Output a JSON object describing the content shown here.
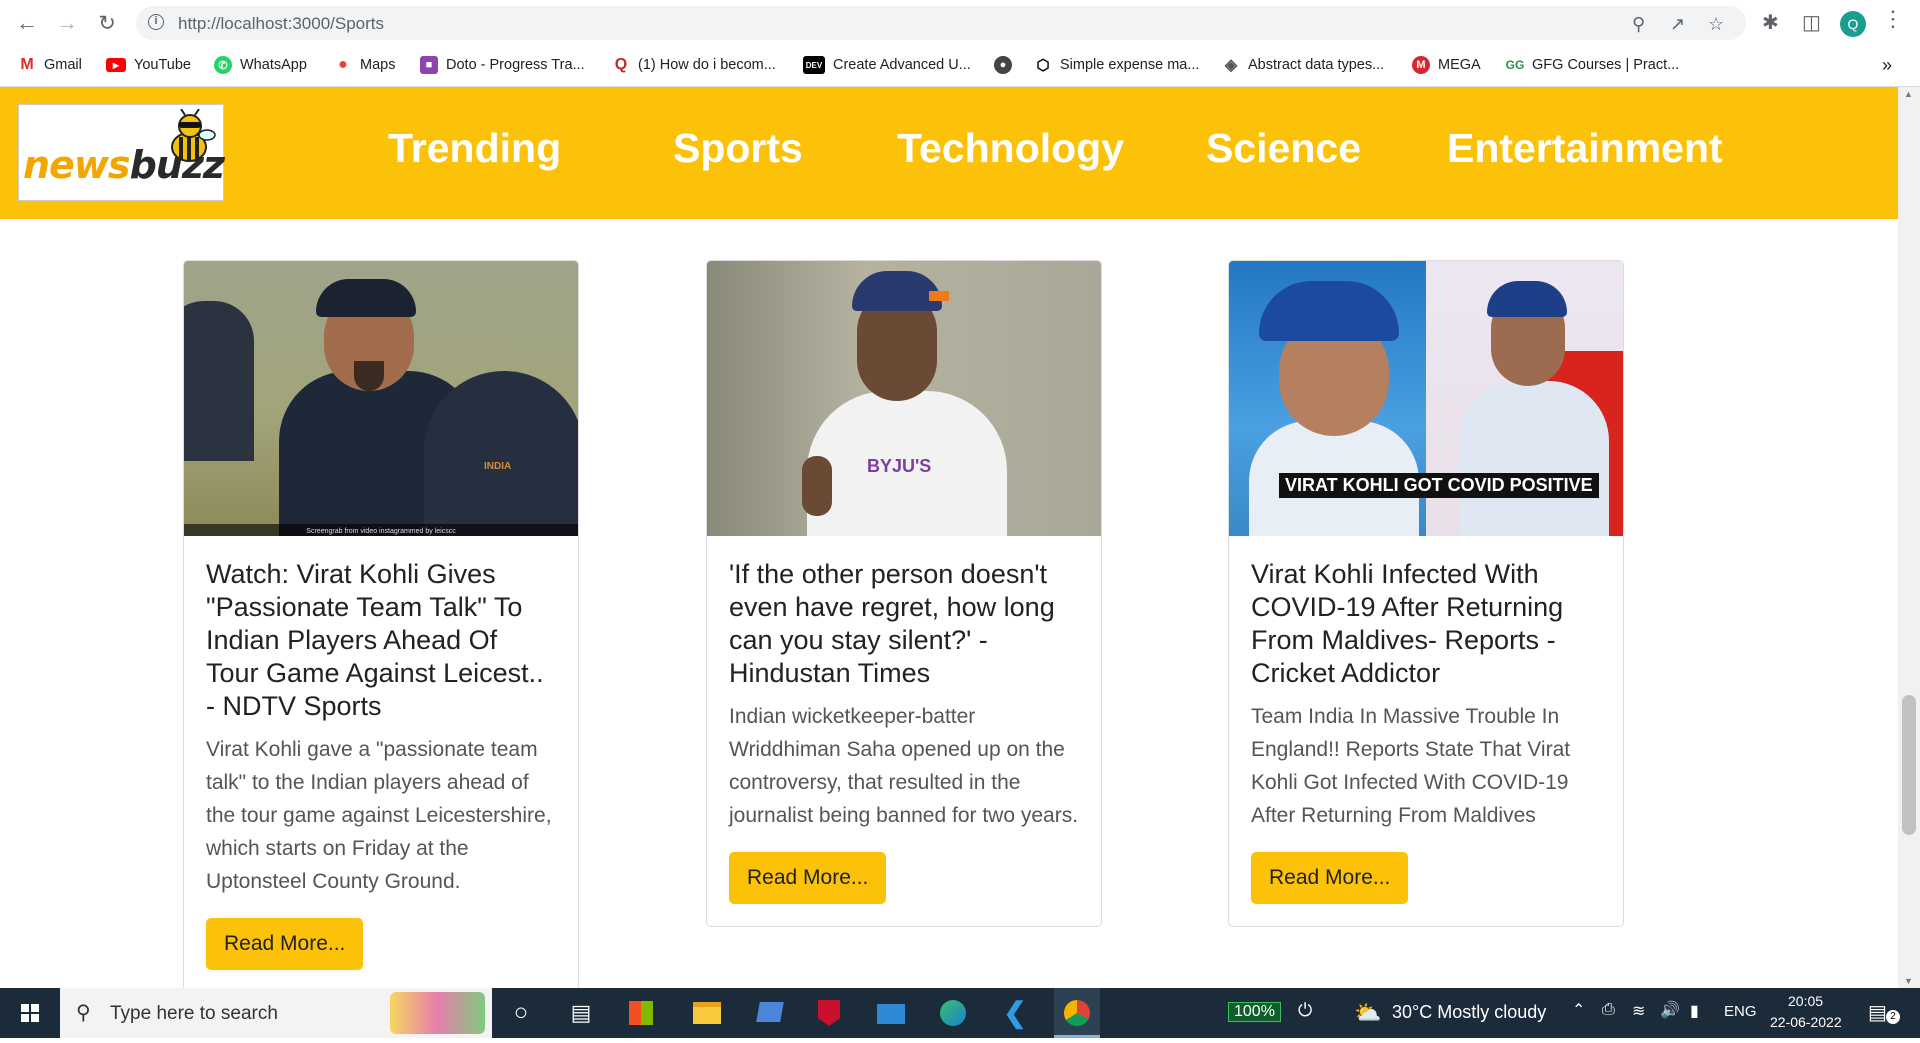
{
  "browser": {
    "url": "http://localhost:3000/Sports",
    "profile_initial": "Q",
    "bookmarks": [
      {
        "label": "Gmail",
        "icon": "gmail-icon"
      },
      {
        "label": "YouTube",
        "icon": "youtube-icon"
      },
      {
        "label": "WhatsApp",
        "icon": "whatsapp-icon"
      },
      {
        "label": "Maps",
        "icon": "maps-icon"
      },
      {
        "label": "Doto - Progress Tra...",
        "icon": "doto-icon"
      },
      {
        "label": "(1) How do i becom...",
        "icon": "quora-icon"
      },
      {
        "label": "Create Advanced U...",
        "icon": "dev-icon"
      },
      {
        "label": "",
        "icon": "globe-icon"
      },
      {
        "label": "Simple expense ma...",
        "icon": "codepen-icon"
      },
      {
        "label": "Abstract data types...",
        "icon": "diamond-icon"
      },
      {
        "label": "MEGA",
        "icon": "mega-icon"
      },
      {
        "label": "GFG Courses | Pract...",
        "icon": "gfg-icon"
      }
    ],
    "overflow": "»"
  },
  "site": {
    "logo": {
      "part1": "ne",
      "part2": "ws",
      "part3": "buzz"
    },
    "nav": [
      "Trending",
      "Sports",
      "Technology",
      "Science",
      "Entertainment"
    ]
  },
  "articles": [
    {
      "title": "Watch: Virat Kohli Gives \"Passionate Team Talk\" To Indian Players Ahead Of Tour Game Against Leicest.. - NDTV Sports",
      "description": "Virat Kohli gave a \"passionate team talk\" to the Indian players ahead of the tour game against Leicestershire, which starts on Friday at the Uptonsteel County Ground.",
      "button": "Read More...",
      "image_caption": "Screengrab from video instagrammed by leicscc"
    },
    {
      "title": "'If the other person doesn't even have regret, how long can you stay silent?' - Hindustan Times",
      "description": "Indian wicketkeeper-batter Wriddhiman Saha opened up on the controversy, that resulted in the journalist being banned for two years.",
      "button": "Read More...",
      "image_caption": "BYJU'S"
    },
    {
      "title": "Virat Kohli Infected With COVID-19 After Returning From Maldives- Reports - Cricket Addictor",
      "description": "Team India In Massive Trouble In England!! Reports State That Virat Kohli Got Infected With COVID-19 After Returning From Maldives",
      "button": "Read More...",
      "image_caption": "VIRAT KOHLI GOT COVID POSITIVE"
    }
  ],
  "taskbar": {
    "search_placeholder": "Type here to search",
    "battery": "100%",
    "weather": "30°C  Mostly cloudy",
    "language": "ENG",
    "time": "20:05",
    "date": "22-06-2022",
    "notification_count": "2"
  }
}
